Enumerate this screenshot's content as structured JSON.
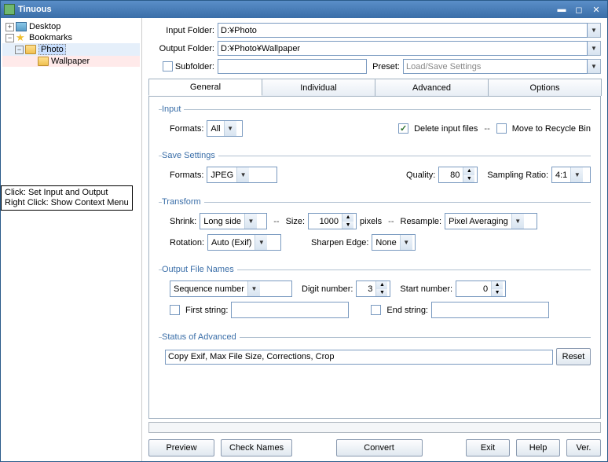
{
  "window": {
    "title": "Tinuous"
  },
  "tree": {
    "desktop": "Desktop",
    "bookmarks": "Bookmarks",
    "photo": "Photo",
    "wallpaper": "Wallpaper"
  },
  "tooltip": {
    "line1": "Click: Set Input and Output",
    "line2": "Right Click: Show Context Menu"
  },
  "paths": {
    "input_label": "Input Folder:",
    "input_value": "D:¥Photo",
    "output_label": "Output Folder:",
    "output_value": "D:¥Photo¥Wallpaper",
    "subfolder_label": "Subfolder:",
    "subfolder_value": "",
    "preset_label": "Preset:",
    "preset_placeholder": "Load/Save Settings"
  },
  "tabs": {
    "general": "General",
    "individual": "Individual",
    "advanced": "Advanced",
    "options": "Options"
  },
  "input_group": {
    "legend": "Input",
    "formats_label": "Formats:",
    "formats_value": "All",
    "delete_label": "Delete input files",
    "sep": "--",
    "recycle_label": "Move to Recycle Bin"
  },
  "save_group": {
    "legend": "Save Settings",
    "formats_label": "Formats:",
    "formats_value": "JPEG",
    "quality_label": "Quality:",
    "quality_value": "80",
    "sampling_label": "Sampling Ratio:",
    "sampling_value": "4:1"
  },
  "transform_group": {
    "legend": "Transform",
    "shrink_label": "Shrink:",
    "shrink_value": "Long side",
    "size_label": "Size:",
    "size_value": "1000",
    "size_suffix": "pixels",
    "resample_label": "Resample:",
    "resample_value": "Pixel Averaging",
    "rotation_label": "Rotation:",
    "rotation_value": "Auto (Exif)",
    "sharpen_label": "Sharpen Edge:",
    "sharpen_value": "None"
  },
  "output_group": {
    "legend": "Output File Names",
    "mode_value": "Sequence number",
    "digit_label": "Digit number:",
    "digit_value": "3",
    "start_label": "Start number:",
    "start_value": "0",
    "first_label": "First string:",
    "first_value": "",
    "end_label": "End string:",
    "end_value": ""
  },
  "status_group": {
    "legend": "Status of Advanced",
    "value": "Copy Exif, Max File Size, Corrections, Crop",
    "reset": "Reset"
  },
  "buttons": {
    "preview": "Preview",
    "check": "Check Names",
    "convert": "Convert",
    "exit": "Exit",
    "help": "Help",
    "ver": "Ver."
  }
}
